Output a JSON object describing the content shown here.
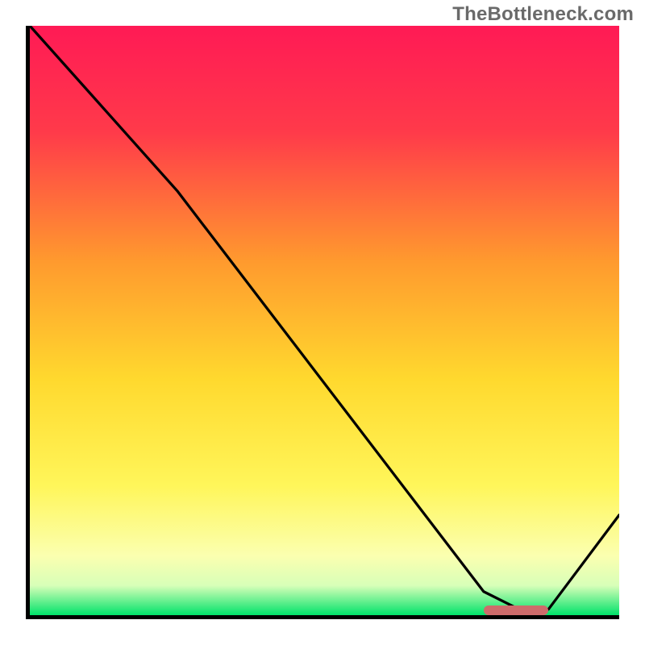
{
  "watermark": "TheBottleneck.com",
  "chart_data": {
    "type": "line",
    "title": "",
    "xlabel": "",
    "ylabel": "",
    "xlim": [
      0,
      100
    ],
    "ylim": [
      0,
      100
    ],
    "grid": false,
    "legend": false,
    "series": [
      {
        "name": "bottleneck-curve",
        "x": [
          0,
          25,
          77,
          83,
          88,
          100
        ],
        "values": [
          100,
          72,
          4,
          1,
          1,
          17
        ]
      }
    ],
    "annotations": [
      {
        "name": "optimal-range-marker",
        "x_start": 77,
        "x_end": 88,
        "y": 0.8
      }
    ],
    "background_gradient": {
      "stops": [
        {
          "offset": 0.0,
          "color": "#ff1a55"
        },
        {
          "offset": 0.18,
          "color": "#ff3a4a"
        },
        {
          "offset": 0.4,
          "color": "#ff9a2e"
        },
        {
          "offset": 0.6,
          "color": "#ffd92e"
        },
        {
          "offset": 0.78,
          "color": "#fff65a"
        },
        {
          "offset": 0.9,
          "color": "#fbffb0"
        },
        {
          "offset": 0.95,
          "color": "#d7ffb8"
        },
        {
          "offset": 1.0,
          "color": "#00e26a"
        }
      ]
    }
  }
}
